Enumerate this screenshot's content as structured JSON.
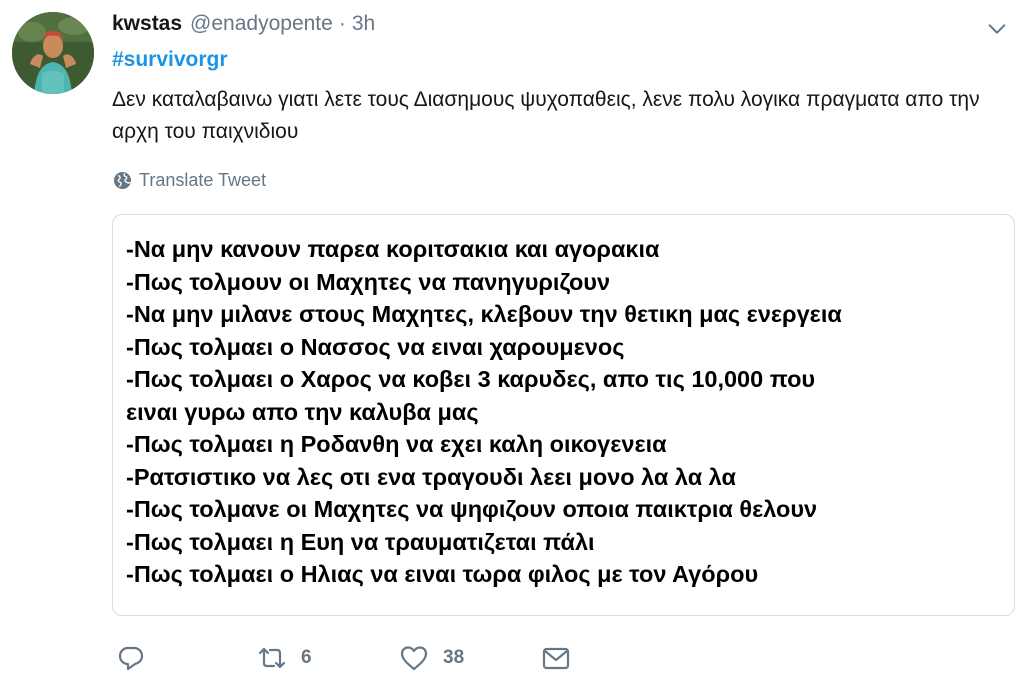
{
  "tweet": {
    "author_name": "kwstas",
    "handle": "@enadyopente",
    "separator": "·",
    "time": "3h",
    "hashtag": "#survivorgr",
    "text": "Δεν καταλαβαινω γιατι λετε τους Διασημους ψυχοπαθεις, λενε πολυ λογικα πραγματα απο την αρχη του παιχνιδιου",
    "translate_label": "Translate Tweet"
  },
  "media": {
    "lines": [
      "-Να μην κανουν παρεα κοριτσακια και αγορακια",
      "-Πως τολμουν οι Μαχητες να πανηγυριζουν",
      "-Να μην μιλανε στους Μαχητες, κλεβουν την θετικη μας ενεργεια",
      "-Πως τολμαει ο Νασσος να ειναι χαρουμενος",
      "-Πως τολμαει ο Χαρος να κοβει 3 καρυδες, απο τις 10,000 που",
      "ειναι γυρω απο την καλυβα μας",
      "-Πως τολμαει η Ροδανθη να εχει καλη οικογενεια",
      "-Ρατσιστικο να λες οτι ενα τραγουδι λεει μονο λα λα λα",
      "-Πως τολμανε οι Μαχητες να ψηφιζουν οποια παικτρια θελουν",
      "-Πως τολμαει η Ευη να τραυματιζεται πάλι",
      "-Πως τολμαει ο Ηλιας να ειναι τωρα φιλος με τον Αγόρου"
    ]
  },
  "actions": {
    "retweet_count": "6",
    "like_count": "38"
  },
  "icons": {
    "caret": "chevron-down-icon",
    "globe": "globe-icon",
    "reply": "reply-icon",
    "retweet": "retweet-icon",
    "like": "heart-icon",
    "message": "envelope-icon"
  },
  "colors": {
    "link": "#1b95e0",
    "secondary": "#657786",
    "text": "#14171a",
    "border": "#d6dde3"
  }
}
